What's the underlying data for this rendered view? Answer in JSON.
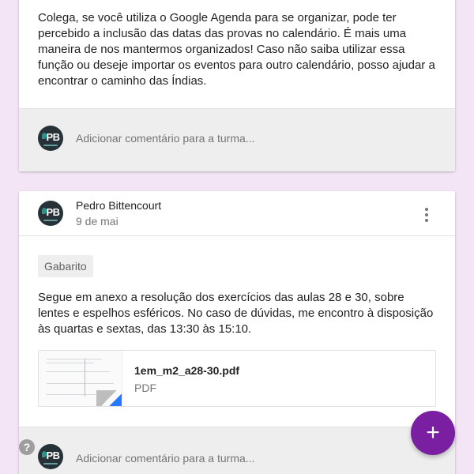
{
  "posts": [
    {
      "body": "Colega, se você utiliza o Google Agenda para se organizar, pode ter percebido a inclusão das datas das provas no calendário. É mais uma maneira de nos mantermos organizados! Caso não saiba utilizar essa função ou deseje importar os eventos para outro calendário, posso ajudar a encontrar o caminho das Índias.",
      "comment_placeholder": "Adicionar comentário para a turma..."
    },
    {
      "author": "Pedro Bittencourt",
      "date": "9 de mai",
      "topic": "Gabarito",
      "body": "Segue em anexo a resolução dos exercícios das aulas 28 e 30, sobre lentes e espelhos esféricos. No caso de dúvidas, me encontro à disposição às quartas e sextas, das 13:30 às 15:10.",
      "attachment": {
        "name": "1em_m2_a28-30.pdf",
        "type": "PDF"
      },
      "comment_placeholder": "Adicionar comentário para a turma..."
    }
  ],
  "avatar": {
    "initials": "PB",
    "icon": "avatar-logo"
  },
  "fab": {
    "label": "+",
    "icon": "add-icon"
  },
  "help": {
    "label": "?",
    "icon": "help-icon"
  },
  "colors": {
    "background": "#f3e5f5",
    "accent": "#7b1fa2",
    "card": "#ffffff",
    "comment_bar": "#eeeeee"
  }
}
